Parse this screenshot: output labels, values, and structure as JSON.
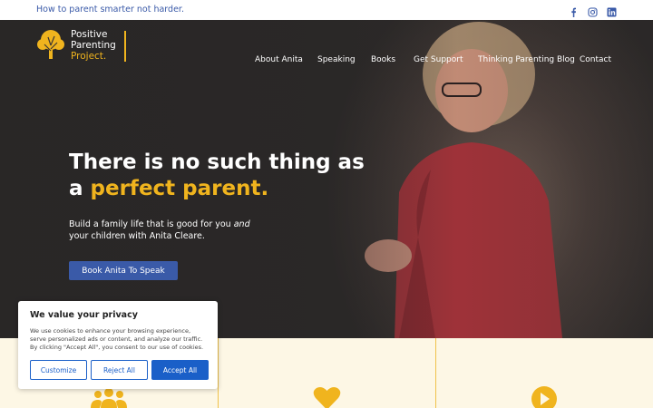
{
  "topbar": {
    "tagline": "How to parent smarter not harder.",
    "social_icons": [
      "facebook-icon",
      "instagram-icon",
      "linkedin-icon"
    ]
  },
  "logo": {
    "line1": "Positive",
    "line2": "Parenting",
    "line3": "Project."
  },
  "nav": {
    "items": [
      "About Anita",
      "Speaking",
      "Books",
      "Get Support",
      "Thinking Parenting Blog",
      "Contact"
    ]
  },
  "hero": {
    "headline_line1": "There is no such thing as",
    "headline_line2_prefix": "a ",
    "headline_line2_accent": "perfect parent.",
    "sub_part1": "Build a family life that is good for you ",
    "sub_em": "and",
    "sub_part2": " your children with Anita Cleare.",
    "cta_label": "Book Anita To Speak"
  },
  "cookie": {
    "title": "We value your privacy",
    "body": "We use cookies to enhance your browsing experience, serve personalized ads or content, and analyze our traffic. By clicking \"Accept All\", you consent to our use of cookies.",
    "customize": "Customize",
    "reject": "Reject All",
    "accept": "Accept All"
  },
  "feature_icons": [
    "group-icon",
    "heart-icon",
    "play-icon"
  ],
  "colors": {
    "accent": "#f0b41e",
    "brand_blue": "#3a5aa8",
    "cookie_blue": "#1a5fc8",
    "card_bg": "#fdf7e5"
  }
}
